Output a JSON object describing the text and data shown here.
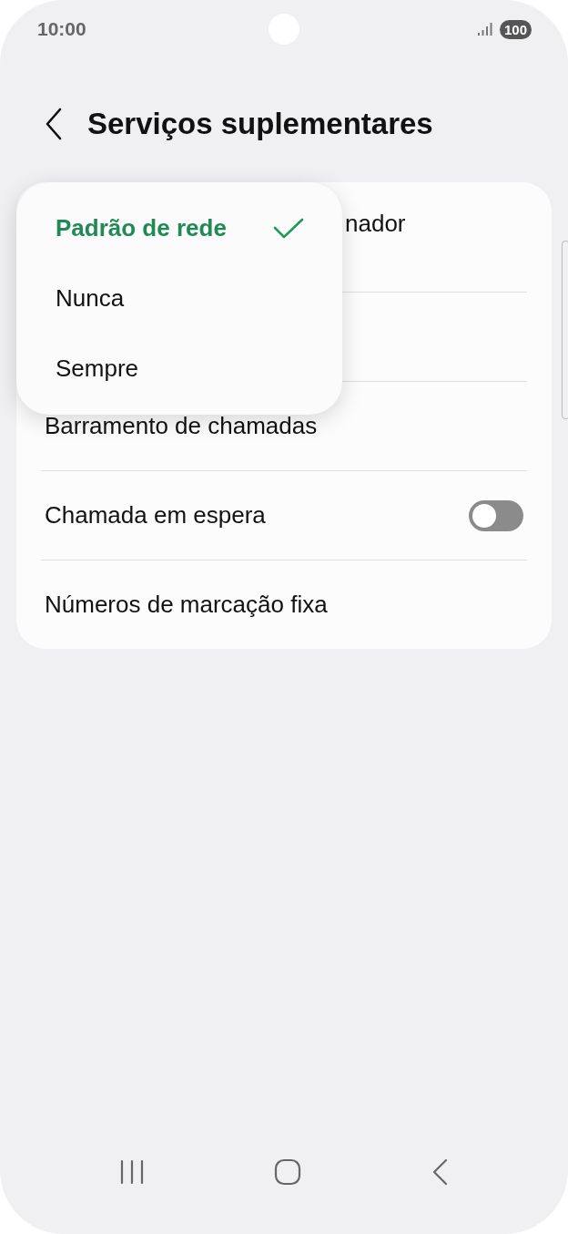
{
  "status_bar": {
    "time": "10:00",
    "battery": "100"
  },
  "header": {
    "title": "Serviços suplementares"
  },
  "settings": [
    {
      "kind": "partial",
      "label": "nador"
    },
    {
      "kind": "hidden"
    },
    {
      "kind": "plain",
      "label": "Barramento de chamadas"
    },
    {
      "kind": "toggle",
      "label": "Chamada em espera",
      "on": false
    },
    {
      "kind": "plain",
      "label": "Números de marcação fixa"
    }
  ],
  "menu": [
    {
      "label": "Padrão de rede",
      "selected": true
    },
    {
      "label": "Nunca",
      "selected": false
    },
    {
      "label": "Sempre",
      "selected": false
    }
  ]
}
